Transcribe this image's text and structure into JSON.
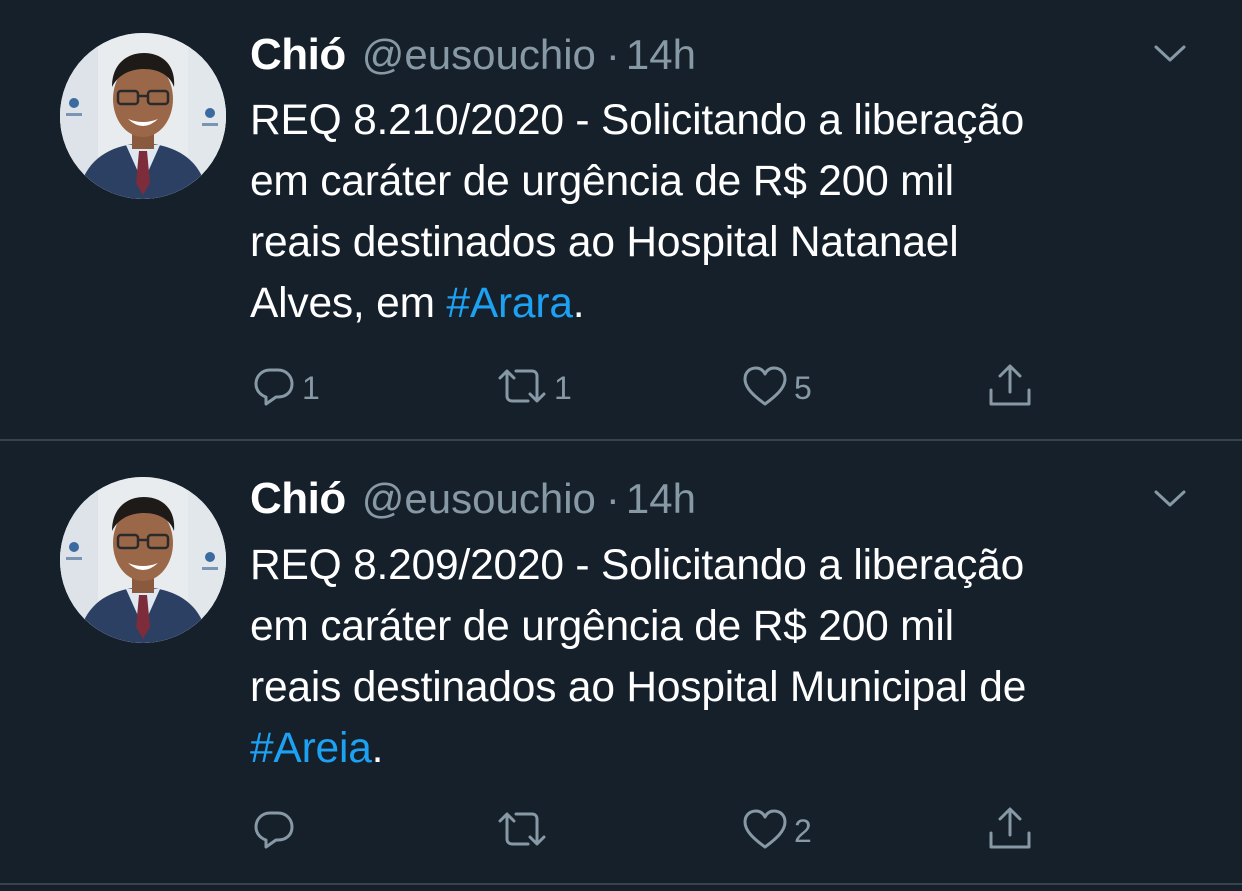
{
  "tweets": [
    {
      "author_name": "Chió",
      "author_handle": "@eusouchio",
      "separator": "·",
      "timestamp": "14h",
      "text_lines": [
        "REQ 8.210/2020 - Solicitando a liberação",
        "em caráter de urgência de R$ 200 mil",
        "reais destinados ao Hospital Natanael"
      ],
      "last_line_prefix": "Alves, em ",
      "hashtag": "#Arara",
      "last_line_suffix": ".",
      "reply_count": "1",
      "retweet_count": "1",
      "like_count": "5",
      "share_count": ""
    },
    {
      "author_name": "Chió",
      "author_handle": "@eusouchio",
      "separator": "·",
      "timestamp": "14h",
      "text_lines": [
        "REQ 8.209/2020 - Solicitando a liberação",
        "em caráter de urgência de R$ 200 mil",
        "reais destinados ao Hospital Municipal de"
      ],
      "last_line_prefix": "",
      "hashtag": "#Areia",
      "last_line_suffix": ".",
      "reply_count": "",
      "retweet_count": "",
      "like_count": "2",
      "share_count": ""
    }
  ],
  "icons": {
    "reply": "speech-bubble-icon",
    "retweet": "retweet-arrows-icon",
    "like": "heart-icon",
    "share": "share-upload-icon",
    "caret": "chevron-down-icon"
  },
  "colors": {
    "background": "#15202b",
    "text": "#ffffff",
    "secondary": "#8899a6",
    "link": "#1da1f2",
    "divider": "#38444d"
  }
}
